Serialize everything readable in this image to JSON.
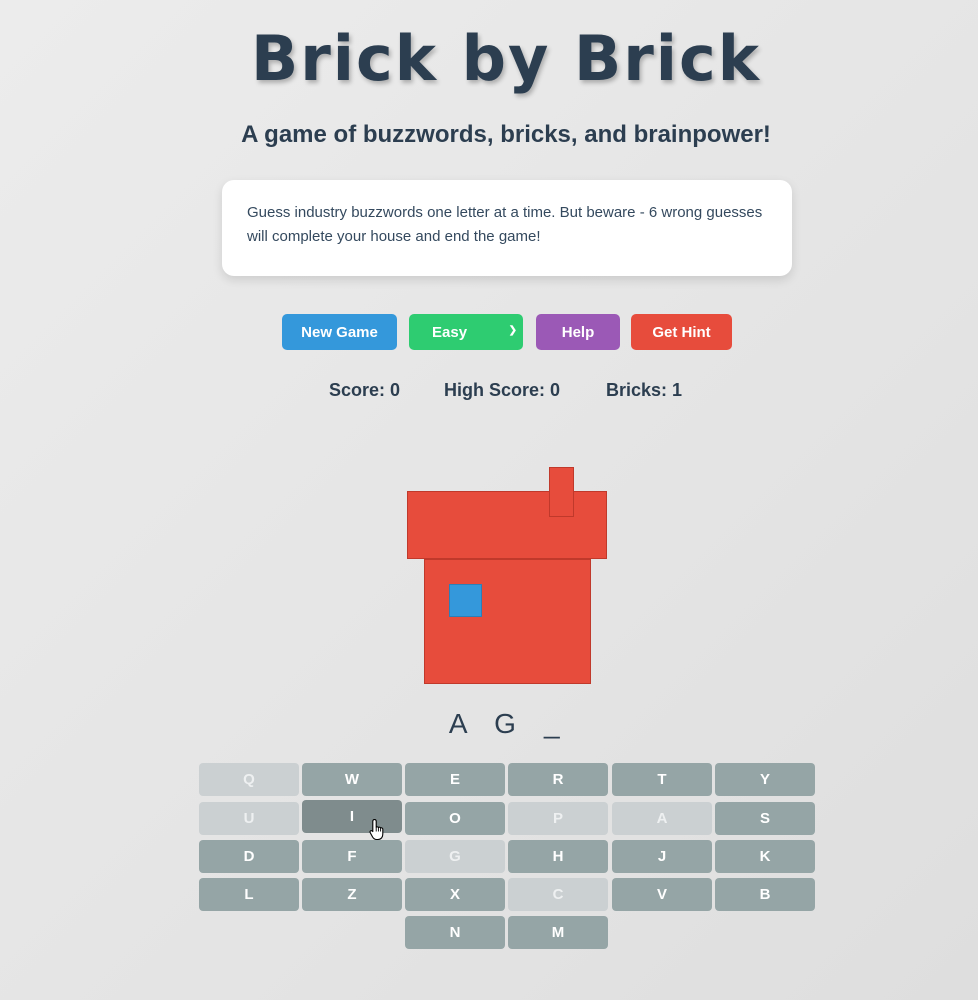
{
  "header": {
    "title": "Brick by Brick",
    "subtitle": "A game of buzzwords, bricks, and brainpower!"
  },
  "info": {
    "text": "Guess industry buzzwords one letter at a time. But beware - 6 wrong guesses will complete your house and end the game!"
  },
  "controls": {
    "new_game": "New Game",
    "difficulty": "Easy",
    "help": "Help",
    "hint": "Get Hint"
  },
  "stats": {
    "score": "Score: 0",
    "high_score": "High Score: 0",
    "bricks": "Bricks: 1"
  },
  "word": [
    "A",
    "G",
    "_"
  ],
  "keyboard": {
    "rows": [
      [
        "Q",
        "W",
        "E",
        "R",
        "T",
        "Y"
      ],
      [
        "U",
        "I",
        "O",
        "P",
        "A",
        "S"
      ],
      [
        "D",
        "F",
        "G",
        "H",
        "J",
        "K"
      ],
      [
        "L",
        "Z",
        "X",
        "C",
        "V",
        "B"
      ],
      [
        "N",
        "M"
      ]
    ],
    "used": [
      "Q",
      "U",
      "P",
      "A",
      "G",
      "C"
    ],
    "hovered": "I"
  },
  "colors": {
    "brick": "#e74c3c",
    "window": "#3498db",
    "key": "#95a5a6",
    "key_used": "#cbd0d2"
  }
}
